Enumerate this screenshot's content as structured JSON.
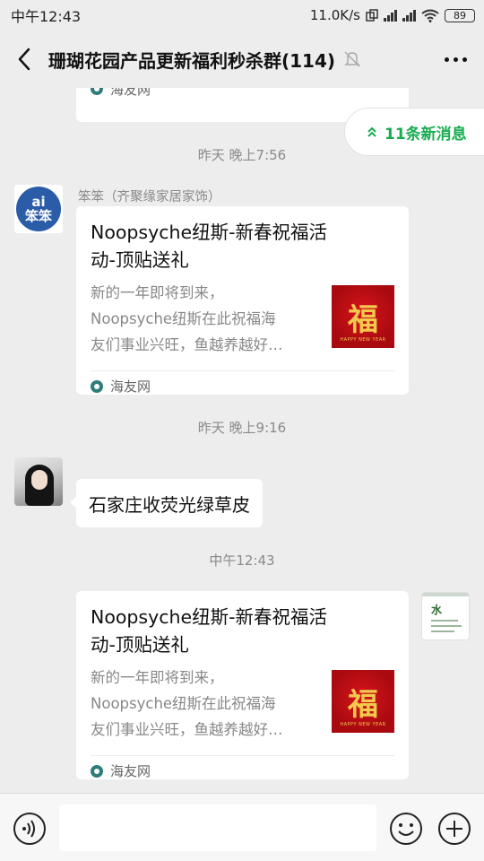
{
  "status_bar": {
    "time": "中午12:43",
    "net_speed": "11.0K/s",
    "hd1": "HD",
    "hd2": "HD",
    "battery": "89"
  },
  "header": {
    "title": "珊瑚花园产品更新福利秒杀群(114)"
  },
  "new_messages": {
    "label": "11条新消息"
  },
  "messages": {
    "prev_card_source": "海友网",
    "time1": "昨天 晚上7:56",
    "sender1": {
      "name": "笨笨（齐聚缘家居家饰）",
      "avatar_text_1": "ai",
      "avatar_text_2": "笨笨"
    },
    "card1": {
      "title_line1": "Noopsyche纽斯-新春祝福活",
      "title_line2": "动-顶贴送礼",
      "desc_line1": "新的一年即将到来，",
      "desc_line2": "Noopsyche纽斯在此祝福海",
      "desc_line3": "友们事业兴旺，鱼越养越好…",
      "thumb_char": "福",
      "thumb_sub": "HAPPY NEW YEAR",
      "source": "海友网"
    },
    "time2": "昨天 晚上9:16",
    "bubble1": "石家庄收荧光绿草皮",
    "time3": "中午12:43",
    "card2": {
      "title_line1": "Noopsyche纽斯-新春祝福活",
      "title_line2": "动-顶贴送礼",
      "desc_line1": "新的一年即将到来，",
      "desc_line2": "Noopsyche纽斯在此祝福海",
      "desc_line3": "友们事业兴旺，鱼越养越好…",
      "thumb_char": "福",
      "thumb_sub": "HAPPY NEW YEAR",
      "source": "海友网"
    },
    "preview_char": "水"
  },
  "input": {
    "value": "",
    "placeholder": ""
  },
  "icons": [
    "back-icon",
    "mute-icon",
    "more-icon",
    "chevron-up-icon",
    "site-icon",
    "voice-icon",
    "emoji-icon",
    "plus-icon"
  ],
  "colors": {
    "accent_green": "#17ad4f",
    "background": "#ededed",
    "card_thumb_red": "#c4101a"
  }
}
